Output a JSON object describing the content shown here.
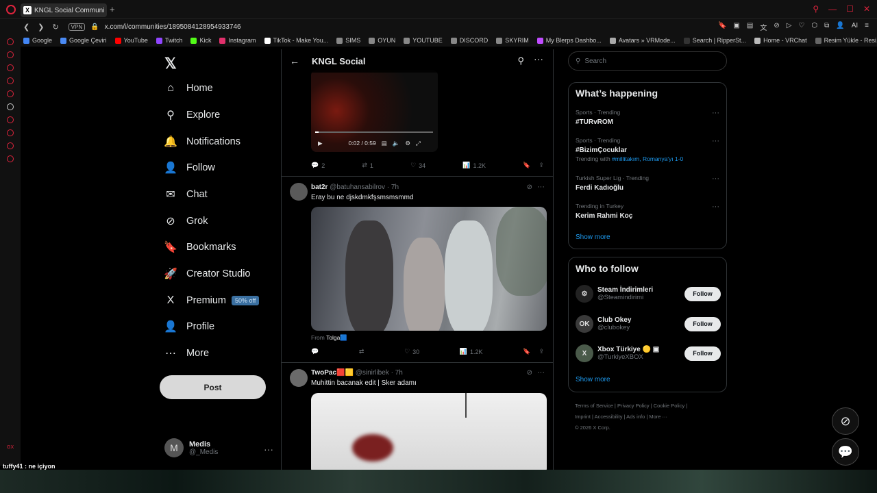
{
  "browser": {
    "tab_title": "KNGL Social Communi",
    "new_tab": "+",
    "url": "x.com/i/communities/1895084128954933746",
    "vpn": "VPN",
    "ext_ai": "AI"
  },
  "bookmarks": [
    {
      "label": "Google",
      "color": "#4285f4"
    },
    {
      "label": "Google Çeviri",
      "color": "#4a8af4"
    },
    {
      "label": "YouTube",
      "color": "#ff0000"
    },
    {
      "label": "Twitch",
      "color": "#9146ff"
    },
    {
      "label": "Kick",
      "color": "#53fc18"
    },
    {
      "label": "Instagram",
      "color": "#e1306c"
    },
    {
      "label": "TikTok - Make You...",
      "color": "#ffffff"
    },
    {
      "label": "SIMS",
      "color": "#888888"
    },
    {
      "label": "OYUN",
      "color": "#888888"
    },
    {
      "label": "YOUTUBE",
      "color": "#888888"
    },
    {
      "label": "DISCORD",
      "color": "#888888"
    },
    {
      "label": "SKYRIM",
      "color": "#888888"
    },
    {
      "label": "My Blerps Dashbo...",
      "color": "#c04cff"
    },
    {
      "label": "Avatars » VRMode...",
      "color": "#aaaaaa"
    },
    {
      "label": "Search | RipperSt...",
      "color": "#333333"
    },
    {
      "label": "Home - VRChat",
      "color": "#bbbbbb"
    },
    {
      "label": "Resim Yükle - Resi...",
      "color": "#666666"
    }
  ],
  "nav": {
    "items": [
      {
        "label": "Home",
        "icon": "⌂"
      },
      {
        "label": "Explore",
        "icon": "⚲"
      },
      {
        "label": "Notifications",
        "icon": "🔔"
      },
      {
        "label": "Follow",
        "icon": "👤"
      },
      {
        "label": "Chat",
        "icon": "✉"
      },
      {
        "label": "Grok",
        "icon": "⊘"
      },
      {
        "label": "Bookmarks",
        "icon": "🔖"
      },
      {
        "label": "Creator Studio",
        "icon": "🚀"
      },
      {
        "label": "Premium",
        "icon": "X"
      },
      {
        "label": "Profile",
        "icon": "👤"
      },
      {
        "label": "More",
        "icon": "⋯"
      }
    ],
    "premium_badge": "50% off",
    "post_label": "Post"
  },
  "account": {
    "initial": "M",
    "name": "Medis",
    "handle": "@_Medis"
  },
  "feed": {
    "title": "KNGL Social",
    "video1": {
      "time": "0:02 / 0:59"
    },
    "tweet1_actions": {
      "replies": "2",
      "reposts": "1",
      "likes": "34",
      "views": "1.2K"
    },
    "tweet2": {
      "name": "bat2r",
      "handle": "@batuhansabilrov · 7h",
      "text": "Eray bu ne djskdmkfşsmsmsmmd",
      "from_label": "From",
      "from_name": "Tolga🟦",
      "likes": "30",
      "views": "1.2K"
    },
    "tweet3": {
      "name": "TwoPac🟥🟨",
      "handle": "@sinirlibek · 7h",
      "text": "Muhittin bacanak edit | Sker adamı"
    }
  },
  "right": {
    "search_placeholder": "Search",
    "happening_title": "What’s happening",
    "trends": [
      {
        "meta": "Sports · Trending",
        "tag": "#TURvROM",
        "sub": "",
        "sublink": ""
      },
      {
        "meta": "Sports · Trending",
        "tag": "#BizimÇocuklar",
        "sub": "Trending with",
        "sublink": "#millitakım, Romanya'yı 1-0"
      },
      {
        "meta": "Turkish Super Lig · Trending",
        "tag": "Ferdi Kadıoğlu",
        "sub": "",
        "sublink": ""
      },
      {
        "meta": "Trending in Turkey",
        "tag": "Kerim Rahmi Koç",
        "sub": "",
        "sublink": ""
      }
    ],
    "show_more": "Show more",
    "wtf_title": "Who to follow",
    "who_to_follow": [
      {
        "name": "Steam İndirimleri",
        "handle": "@Steamindirimi",
        "avatar": "⚙",
        "follow": "Follow"
      },
      {
        "name": "Club Okey",
        "handle": "@clubokey",
        "avatar": "OK",
        "follow": "Follow"
      },
      {
        "name": "Xbox Türkiye 🟡 ▣",
        "handle": "@TurkiyeXBOX",
        "avatar": "X",
        "follow": "Follow"
      }
    ],
    "footer": {
      "l1": "Terms of Service  |  Privacy Policy  |  Cookie Policy  |",
      "l2": "Imprint  |  Accessibility  |  Ads info  |  More ···",
      "l3": "© 2026 X Corp."
    }
  },
  "overlay": {
    "chat_message": "tuffy41 : ne içiyon",
    "gx": "GX"
  }
}
